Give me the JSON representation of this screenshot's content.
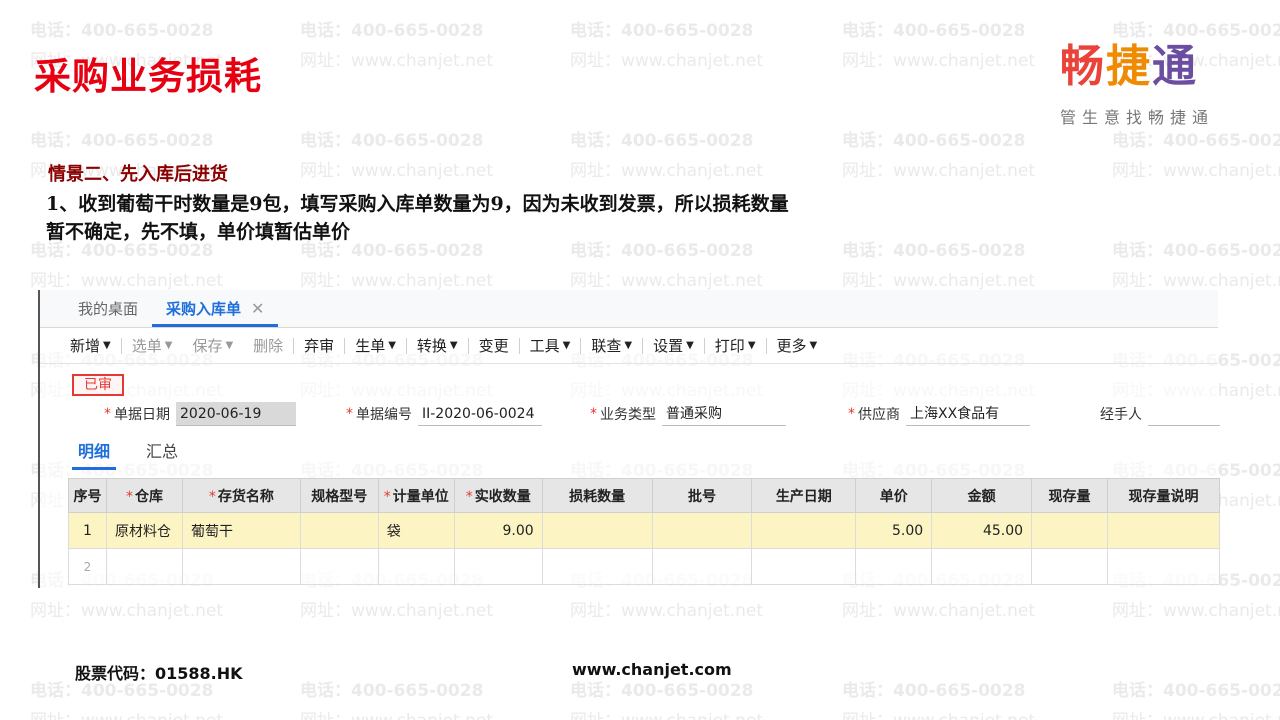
{
  "slide": {
    "title": "采购业务损耗",
    "scene_heading": "情景二、先入库后进货",
    "scene_line1": "1、收到葡萄干时数量是9包，填写采购入库单数量为9，因为未收到发票，所以损耗数量",
    "scene_line2": "暂不确定，先不填，单价填暂估单价"
  },
  "logo": {
    "c1": "畅",
    "c2": "捷",
    "c3": "通",
    "tagline": "管生意找畅捷通"
  },
  "watermark": {
    "line1": "电话：400-665-0028",
    "line2": "网址：www.chanjet.net"
  },
  "app": {
    "tabs": [
      {
        "label": "我的桌面"
      },
      {
        "label": "采购入库单"
      }
    ],
    "toolbar": {
      "new": "新增",
      "select": "选单",
      "save": "保存",
      "delete": "删除",
      "unaudit": "弃审",
      "generate": "生单",
      "convert": "转换",
      "change": "变更",
      "tools": "工具",
      "query": "联查",
      "settings": "设置",
      "print": "打印",
      "more": "更多"
    },
    "status": "已审",
    "form": {
      "date_label": "单据日期",
      "date_value": "2020-06-19",
      "no_label": "单据编号",
      "no_value": "II-2020-06-0024",
      "type_label": "业务类型",
      "type_value": "普通采购",
      "supplier_label": "供应商",
      "supplier_value": "上海XX食品有限...",
      "handler_label": "经手人"
    },
    "subtabs": [
      "明细",
      "汇总"
    ],
    "grid": {
      "headers": {
        "seq": "序号",
        "warehouse": "仓库",
        "item": "存货名称",
        "spec": "规格型号",
        "unit": "计量单位",
        "qty": "实收数量",
        "loss": "损耗数量",
        "batch": "批号",
        "mfg": "生产日期",
        "price": "单价",
        "amount": "金额",
        "stock": "现存量",
        "stock_note": "现存量说明"
      },
      "rows": [
        {
          "seq": "1",
          "warehouse": "原材料仓",
          "item": "葡萄干",
          "spec": "",
          "unit": "袋",
          "qty": "9.00",
          "loss": "",
          "batch": "",
          "mfg": "",
          "price": "5.00",
          "amount": "45.00",
          "stock": "",
          "stock_note": ""
        },
        {
          "seq": "2"
        }
      ]
    }
  },
  "footer": {
    "stock_code": "股票代码：01588.HK",
    "website": "www.chanjet.com"
  }
}
